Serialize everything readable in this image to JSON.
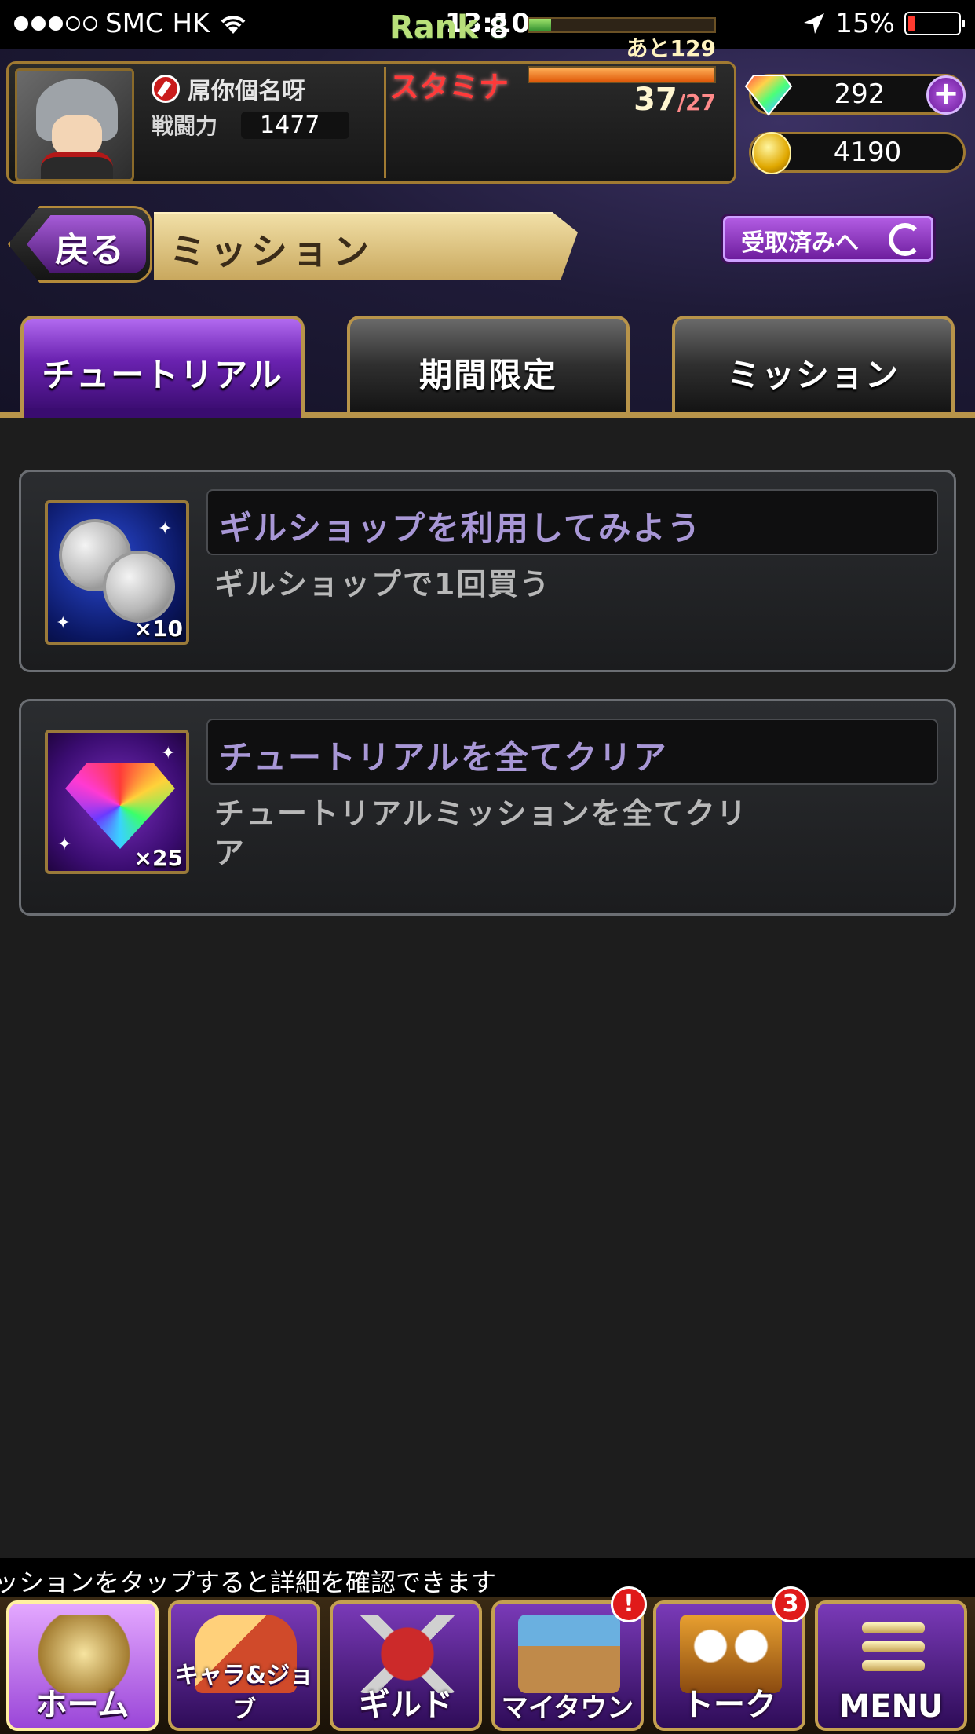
{
  "status_bar": {
    "carrier": "SMC HK",
    "time": "13:10",
    "battery": "15%",
    "signal_icon": "signal-dots-icon",
    "wifi_icon": "wifi-icon",
    "location_icon": "location-arrow-icon",
    "battery_icon": "battery-low-icon"
  },
  "player": {
    "name": "屌你個名呀",
    "power_label": "戦闘力",
    "power": "1477",
    "rank_label": "Rank",
    "rank": "8",
    "exp_fraction": 0.12,
    "exp_remaining": "あと129",
    "stamina_label": "スタミナ",
    "stamina_current": "37",
    "stamina_max": "/27",
    "stamina_fraction": 1.0
  },
  "currency": {
    "gems": "292",
    "gil": "4190",
    "add_button": "+"
  },
  "navigation": {
    "back_label": "戻る",
    "page_title": "ミッション",
    "received_button": "受取済みへ"
  },
  "tabs": [
    {
      "label": "チュートリアル",
      "active": true
    },
    {
      "label": "期間限定",
      "active": false
    },
    {
      "label": "ミッション",
      "active": false
    }
  ],
  "missions": [
    {
      "title": "ギルショップを利用してみよう",
      "description": "ギルショップで1回買う",
      "reward_icon": "silver-coins-icon",
      "reward_qty": "×10"
    },
    {
      "title": "チュートリアルを全てクリア",
      "description": "チュートリアルミッションを全てクリア",
      "reward_icon": "rainbow-gem-icon",
      "reward_qty": "×25"
    }
  ],
  "hint": "ッションをタップすると詳細を確認できます",
  "bottom_nav": [
    {
      "label": "ホーム",
      "icon": "home-icon",
      "active": true
    },
    {
      "label": "キャラ&ジョブ",
      "icon": "character-job-icon"
    },
    {
      "label": "ギルド",
      "icon": "guild-icon"
    },
    {
      "label": "マイタウン",
      "icon": "my-town-icon",
      "badge": "!"
    },
    {
      "label": "トーク",
      "icon": "talk-icon",
      "badge": "3"
    },
    {
      "label": "MENU",
      "icon": "menu-icon"
    }
  ],
  "colors": {
    "accent_purple": "#6a22b0",
    "gold_border": "#b8944a",
    "mission_title": "#a897d6",
    "stamina_red": "#ff3a3a",
    "rank_green": "#b8e07a"
  }
}
